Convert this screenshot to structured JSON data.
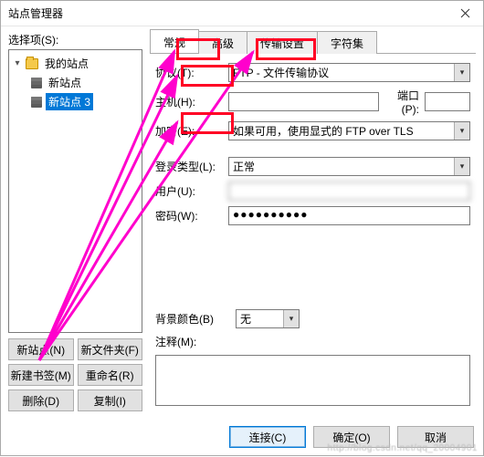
{
  "window": {
    "title": "站点管理器"
  },
  "left": {
    "select_label": "选择项(S):",
    "my_sites": "我的站点",
    "items": [
      "新站点",
      "新站点 3"
    ],
    "buttons": {
      "new_site": "新站点(N)",
      "new_folder": "新文件夹(F)",
      "new_bookmark": "新建书签(M)",
      "rename": "重命名(R)",
      "delete": "删除(D)",
      "copy": "复制(I)"
    }
  },
  "tabs": {
    "general": "常规",
    "advanced": "高级",
    "transfer": "传输设置",
    "charset": "字符集"
  },
  "form": {
    "protocol_label": "协议(T):",
    "protocol_value": "FTP - 文件传输协议",
    "host_label": "主机(H):",
    "host_value": "",
    "port_label": "端口(P):",
    "port_value": "",
    "encryption_label": "加密(E):",
    "encryption_value": "如果可用，使用显式的 FTP over TLS",
    "logon_label": "登录类型(L):",
    "logon_value": "正常",
    "user_label": "用户(U):",
    "user_value": "",
    "password_label": "密码(W):",
    "password_masked": "●●●●●●●●●●",
    "bgcolor_label": "背景颜色(B)",
    "bgcolor_value": "无",
    "comments_label": "注释(M):"
  },
  "dialog": {
    "connect": "连接(C)",
    "ok": "确定(O)",
    "cancel": "取消"
  },
  "watermark": "http://blog.csdn.net/qq_20004901"
}
